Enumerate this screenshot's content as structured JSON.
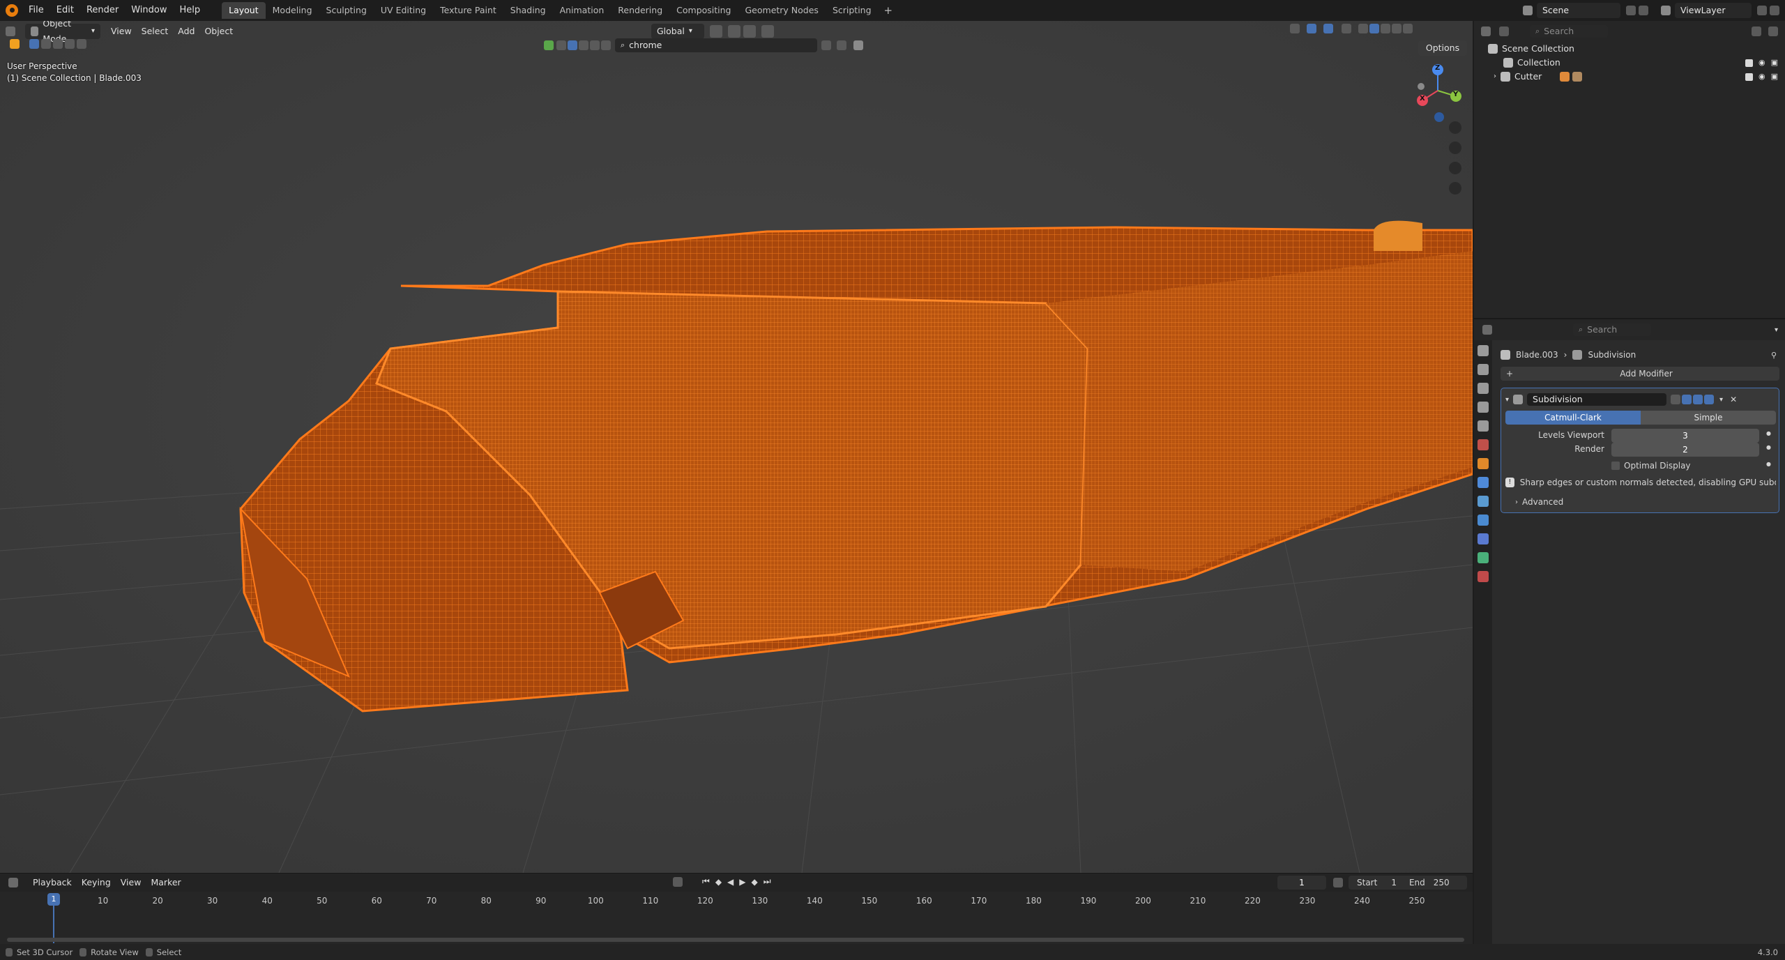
{
  "topbar": {
    "menus": [
      "File",
      "Edit",
      "Render",
      "Window",
      "Help"
    ],
    "workspaces": [
      "Layout",
      "Modeling",
      "Sculpting",
      "UV Editing",
      "Texture Paint",
      "Shading",
      "Animation",
      "Rendering",
      "Compositing",
      "Geometry Nodes",
      "Scripting"
    ],
    "active_workspace": "Layout",
    "scene": "Scene",
    "view_layer": "ViewLayer"
  },
  "viewport": {
    "mode": "Object Mode",
    "menus": [
      "View",
      "Select",
      "Add",
      "Object"
    ],
    "orientation": "Global",
    "search_value": "chrome",
    "options_label": "Options",
    "overlay_line1": "User Perspective",
    "overlay_line2": "(1) Scene Collection | Blade.003",
    "gizmo": {
      "z": "Z",
      "y": "Y",
      "x": "X"
    }
  },
  "outliner": {
    "search_placeholder": "Search",
    "root": "Scene Collection",
    "items": [
      "Collection",
      "Cutter"
    ]
  },
  "properties": {
    "search_placeholder": "Search",
    "breadcrumb_object": "Blade.003",
    "breadcrumb_modifier": "Subdivision",
    "add_modifier": "Add Modifier",
    "modifier_name": "Subdivision",
    "type_catmull": "Catmull-Clark",
    "type_simple": "Simple",
    "levels_viewport_label": "Levels Viewport",
    "levels_viewport_value": "3",
    "render_label": "Render",
    "render_value": "2",
    "optimal_display": "Optimal Display",
    "warning": "Sharp edges or custom normals detected, disabling GPU subdivis...",
    "advanced": "Advanced"
  },
  "timeline": {
    "menus": [
      "Playback",
      "Keying",
      "View",
      "Marker"
    ],
    "current_frame": "1",
    "start_label": "Start",
    "start_value": "1",
    "end_label": "End",
    "end_value": "250",
    "ticks": [
      "10",
      "20",
      "30",
      "40",
      "50",
      "60",
      "70",
      "80",
      "90",
      "100",
      "110",
      "120",
      "130",
      "140",
      "150",
      "160",
      "170",
      "180",
      "190",
      "200",
      "210",
      "220",
      "230",
      "240",
      "250"
    ],
    "playhead": "1"
  },
  "statusbar": {
    "hint1": "Set 3D Cursor",
    "hint2": "Rotate View",
    "hint3": "Select",
    "version": "4.3.0"
  },
  "colors": {
    "accent": "#4772b3",
    "selection_orange": "#e8650a",
    "active_tab": "#3f3f3f"
  }
}
